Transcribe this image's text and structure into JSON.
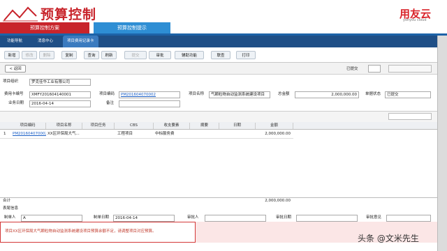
{
  "header": {
    "title": "预算控制",
    "logo": "用友云",
    "logo_sub": "yonyou cloud",
    "tabs": [
      "预算控制方案",
      "预算控制提示"
    ]
  },
  "nav": {
    "items": [
      "功能导航",
      "消息中心",
      "项目费用记录卡"
    ]
  },
  "toolbar": {
    "buttons": [
      "新增",
      "修改",
      "删除",
      "复制",
      "查询",
      "刷新",
      "提交",
      "审批",
      "辅助功能",
      "联查",
      "打印"
    ]
  },
  "subbar": {
    "back": "< 返回",
    "status": "已提交"
  },
  "form": {
    "org_label": "项目组织",
    "org_value": "罗克佳华工业有限公司",
    "card_no_label": "费用卡编号",
    "card_no_value": "XMFY201604140001",
    "proj_code_label": "项目编码",
    "proj_code_value": "PM201604070002",
    "proj_name_label": "项目名称",
    "proj_name_value": "气颗粒物自动监测系统建设项目",
    "total_label": "总金额",
    "total_value": "2,000,000.00",
    "status_label": "单据状态",
    "status_value": "已提交",
    "date_label": "业务日期",
    "date_value": "2016-04-14",
    "note_label": "备注"
  },
  "grid": {
    "columns": [
      "项目编码",
      "项目名称",
      "项目任务",
      "CBS",
      "收支要素",
      "摘要",
      "日期",
      "金额"
    ],
    "row": {
      "index": "1",
      "code": "PM2016040700021",
      "name": "XX区环保局大气...",
      "task": "",
      "cbs": "工程项目",
      "element": "中标服务费",
      "summary": "",
      "date": "",
      "amount": "2,000,000.00"
    },
    "total_label": "合计",
    "total_value": "2,000,000.00"
  },
  "footer": {
    "section": "表尾信息",
    "creator_label": "制单人",
    "creator_value": "A",
    "made_date_label": "制单日期",
    "made_date_value": "2016-04-14",
    "approver_label": "审批人",
    "approve_date_label": "审批日期",
    "opinion_label": "审批意见"
  },
  "error_message": "项目XX区环保局大气颗粒物自动监测系统建设项目预算余额不足，请调整项目对应预算。",
  "watermark": "头条 @文米先生"
}
